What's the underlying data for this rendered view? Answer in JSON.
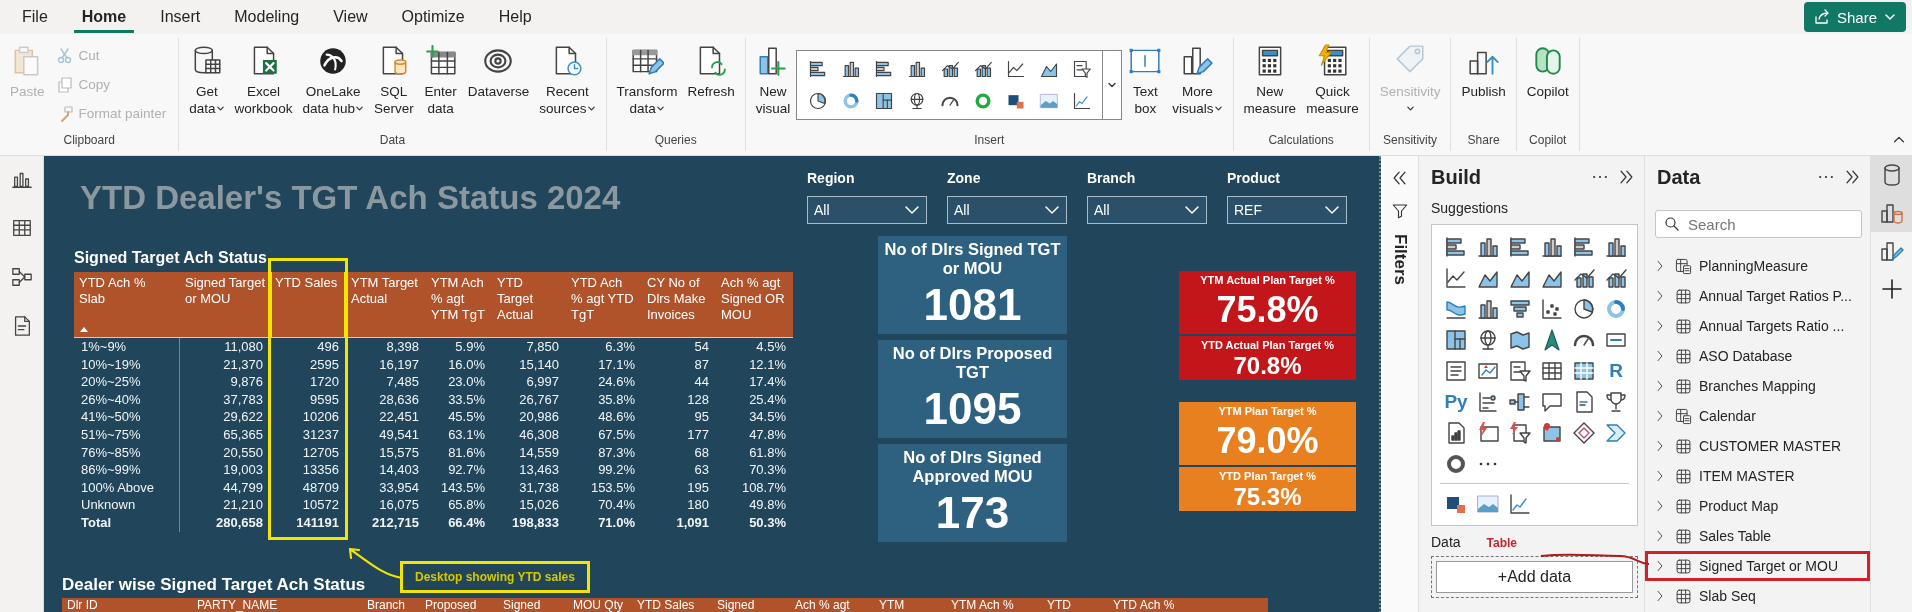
{
  "menu": [
    {
      "label": "File",
      "selected": false
    },
    {
      "label": "Home",
      "selected": true
    },
    {
      "label": "Insert",
      "selected": false
    },
    {
      "label": "Modeling",
      "selected": false
    },
    {
      "label": "View",
      "selected": false
    },
    {
      "label": "Optimize",
      "selected": false
    },
    {
      "label": "Help",
      "selected": false
    }
  ],
  "share_button": "Share",
  "ribbon": [
    {
      "label": "Clipboard",
      "items": [
        {
          "kind": "large",
          "lines": [
            "Paste"
          ],
          "disabled": true,
          "dropdown": false
        },
        {
          "kind": "stack",
          "items": [
            {
              "label": "Cut",
              "disabled": true
            },
            {
              "label": "Copy",
              "disabled": true
            },
            {
              "label": "Format painter",
              "disabled": true
            }
          ]
        }
      ]
    },
    {
      "label": "Data",
      "items": [
        {
          "kind": "large",
          "lines": [
            "Get",
            "data"
          ],
          "disabled": false,
          "dropdown": true
        },
        {
          "kind": "large",
          "lines": [
            "Excel",
            "workbook"
          ],
          "disabled": false,
          "dropdown": false
        },
        {
          "kind": "large",
          "lines": [
            "OneLake",
            "data hub"
          ],
          "disabled": false,
          "dropdown": true
        },
        {
          "kind": "large",
          "lines": [
            "SQL",
            "Server"
          ],
          "disabled": false,
          "dropdown": false
        },
        {
          "kind": "large",
          "lines": [
            "Enter",
            "data"
          ],
          "disabled": false,
          "dropdown": false
        },
        {
          "kind": "large",
          "lines": [
            "Dataverse"
          ],
          "disabled": false,
          "dropdown": false
        },
        {
          "kind": "large",
          "lines": [
            "Recent",
            "sources"
          ],
          "disabled": false,
          "dropdown": true
        }
      ]
    },
    {
      "label": "Queries",
      "items": [
        {
          "kind": "large",
          "lines": [
            "Transform",
            "data"
          ],
          "disabled": false,
          "dropdown": true
        },
        {
          "kind": "large",
          "lines": [
            "Refresh"
          ],
          "disabled": false,
          "dropdown": false
        }
      ]
    },
    {
      "label": "Insert",
      "items": [
        {
          "kind": "large",
          "lines": [
            "New",
            "visual"
          ],
          "disabled": false,
          "dropdown": false
        },
        {
          "kind": "gallery"
        },
        {
          "kind": "large",
          "lines": [
            "Text",
            "box"
          ],
          "disabled": false,
          "dropdown": false
        },
        {
          "kind": "large",
          "lines": [
            "More",
            "visuals"
          ],
          "disabled": false,
          "dropdown": true
        }
      ]
    },
    {
      "label": "Calculations",
      "items": [
        {
          "kind": "large",
          "lines": [
            "New",
            "measure"
          ],
          "disabled": false,
          "dropdown": false
        },
        {
          "kind": "large",
          "lines": [
            "Quick",
            "measure"
          ],
          "disabled": false,
          "dropdown": false
        }
      ]
    },
    {
      "label": "Sensitivity",
      "items": [
        {
          "kind": "large",
          "lines": [
            "Sensitivity"
          ],
          "disabled": true,
          "dropdown": true
        }
      ]
    },
    {
      "label": "Share",
      "items": [
        {
          "kind": "large",
          "lines": [
            "Publish"
          ],
          "disabled": false,
          "dropdown": false
        }
      ]
    },
    {
      "label": "Copilot",
      "items": [
        {
          "kind": "large",
          "lines": [
            "Copilot"
          ],
          "disabled": false,
          "dropdown": false
        }
      ]
    }
  ],
  "report": {
    "title": "YTD Dealer's TGT Ach Status 2024",
    "slicers": [
      {
        "label": "Region",
        "value": "All"
      },
      {
        "label": "Zone",
        "value": "All"
      },
      {
        "label": "Branch",
        "value": "All"
      },
      {
        "label": "Product",
        "value": "REF"
      }
    ],
    "summary_table": {
      "title": "Signed Target Ach Status",
      "columns": [
        {
          "label": "YTD Ach % Slab",
          "sorted": true,
          "highlighted": false
        },
        {
          "label": "Signed Target or MOU",
          "sorted": false,
          "highlighted": false
        },
        {
          "label": "YTD Sales",
          "sorted": false,
          "highlighted": true
        },
        {
          "label": "YTM Target Actual",
          "sorted": false,
          "highlighted": false
        },
        {
          "label": "YTM Ach % agt YTM TgT",
          "sorted": false,
          "highlighted": false
        },
        {
          "label": "YTD Target Actual",
          "sorted": false,
          "highlighted": false
        },
        {
          "label": "YTD Ach % agt YTD TgT",
          "sorted": false,
          "highlighted": false
        },
        {
          "label": "CY No of Dlrs Make Invoices",
          "sorted": false,
          "highlighted": false
        },
        {
          "label": "Ach % agt Signed OR MOU",
          "sorted": false,
          "highlighted": false
        }
      ],
      "rows": [
        [
          "1%~9%",
          "11,080",
          "496",
          "8,398",
          "5.9%",
          "7,850",
          "6.3%",
          "54",
          "4.5%"
        ],
        [
          "10%~19%",
          "21,370",
          "2595",
          "16,197",
          "16.0%",
          "15,140",
          "17.1%",
          "87",
          "12.1%"
        ],
        [
          "20%~25%",
          "9,876",
          "1720",
          "7,485",
          "23.0%",
          "6,997",
          "24.6%",
          "44",
          "17.4%"
        ],
        [
          "26%~40%",
          "37,783",
          "9595",
          "28,636",
          "33.5%",
          "26,767",
          "35.8%",
          "128",
          "25.4%"
        ],
        [
          "41%~50%",
          "29,622",
          "10206",
          "22,451",
          "45.5%",
          "20,986",
          "48.6%",
          "95",
          "34.5%"
        ],
        [
          "51%~75%",
          "65,365",
          "31237",
          "49,541",
          "63.1%",
          "46,308",
          "67.5%",
          "177",
          "47.8%"
        ],
        [
          "76%~85%",
          "20,550",
          "12705",
          "15,575",
          "81.6%",
          "14,559",
          "87.3%",
          "68",
          "61.8%"
        ],
        [
          "86%~99%",
          "19,003",
          "13356",
          "14,403",
          "92.7%",
          "13,463",
          "99.2%",
          "63",
          "70.3%"
        ],
        [
          "100% Above",
          "44,799",
          "48709",
          "33,954",
          "143.5%",
          "31,738",
          "153.5%",
          "195",
          "108.7%"
        ],
        [
          "Unknown",
          "21,210",
          "10572",
          "16,075",
          "65.8%",
          "15,026",
          "70.4%",
          "180",
          "49.8%"
        ]
      ],
      "total": [
        "Total",
        "280,658",
        "141191",
        "212,715",
        "66.4%",
        "198,833",
        "71.0%",
        "1,091",
        "50.3%"
      ]
    },
    "cards": [
      {
        "title": "No of Dlrs Signed TGT or MOU",
        "value": "1081"
      },
      {
        "title": "No of Dlrs Proposed TGT",
        "value": "1095"
      },
      {
        "title": "No of Dlrs Signed Approved MOU",
        "value": "173"
      }
    ],
    "kpis": [
      {
        "title": "YTM Actual Plan Target %",
        "value": "75.8%",
        "color": "#c2161b",
        "kind": "primary"
      },
      {
        "title": "YTD Actual Plan Target %",
        "value": "70.8%",
        "color": "#c2161b",
        "kind": "secondary"
      },
      {
        "title": "YTM Plan Target %",
        "value": "79.0%",
        "color": "#e9801f",
        "kind": "primary"
      },
      {
        "title": "YTD Plan Target %",
        "value": "75.3%",
        "color": "#e9801f",
        "kind": "secondary"
      }
    ],
    "callout": "Desktop showing YTD sales",
    "dealer_table": {
      "title": "Dealer wise Signed Target Ach Status",
      "columns": [
        "Dlr ID",
        "PARTY_NAME",
        "Branch",
        "Proposed",
        "Signed",
        "MOU Qty",
        "YTD Sales",
        "Signed",
        "Ach % agt",
        "YTM",
        "YTM Ach %",
        "YTD",
        "YTD Ach %"
      ]
    }
  },
  "filters_label": "Filters",
  "build": {
    "title": "Build",
    "suggestions": "Suggestions",
    "letter_icons": [
      "R",
      "Py"
    ],
    "data_label": "Data",
    "note": "Table",
    "add_data": "+Add data"
  },
  "data_pane": {
    "title": "Data",
    "search": {
      "placeholder": "Search"
    },
    "items": [
      {
        "label": "PlanningMeasure",
        "kind": "measure",
        "expanded": false,
        "highlighted": false
      },
      {
        "label": "Annual Target Ratios P...",
        "kind": "table",
        "expanded": false,
        "highlighted": false
      },
      {
        "label": "Annual Targets Ratio ...",
        "kind": "table",
        "expanded": false,
        "highlighted": false
      },
      {
        "label": "ASO Database",
        "kind": "table",
        "expanded": false,
        "highlighted": false
      },
      {
        "label": "Branches Mapping",
        "kind": "table",
        "expanded": false,
        "highlighted": false
      },
      {
        "label": "Calendar",
        "kind": "measure",
        "expanded": false,
        "highlighted": false
      },
      {
        "label": "CUSTOMER MASTER",
        "kind": "table",
        "expanded": false,
        "highlighted": false
      },
      {
        "label": "ITEM MASTER",
        "kind": "table",
        "expanded": false,
        "highlighted": false
      },
      {
        "label": "Product Map",
        "kind": "table",
        "expanded": false,
        "highlighted": false
      },
      {
        "label": "Sales Table",
        "kind": "table",
        "expanded": false,
        "highlighted": false
      },
      {
        "label": "Signed Target or MOU",
        "kind": "table",
        "expanded": false,
        "highlighted": true
      },
      {
        "label": "Slab Seq",
        "kind": "table",
        "expanded": false,
        "highlighted": false
      }
    ]
  },
  "pane_switcher": [
    {
      "selected": true
    },
    {
      "selected": true
    },
    {
      "selected": false
    },
    {
      "selected": false
    }
  ]
}
